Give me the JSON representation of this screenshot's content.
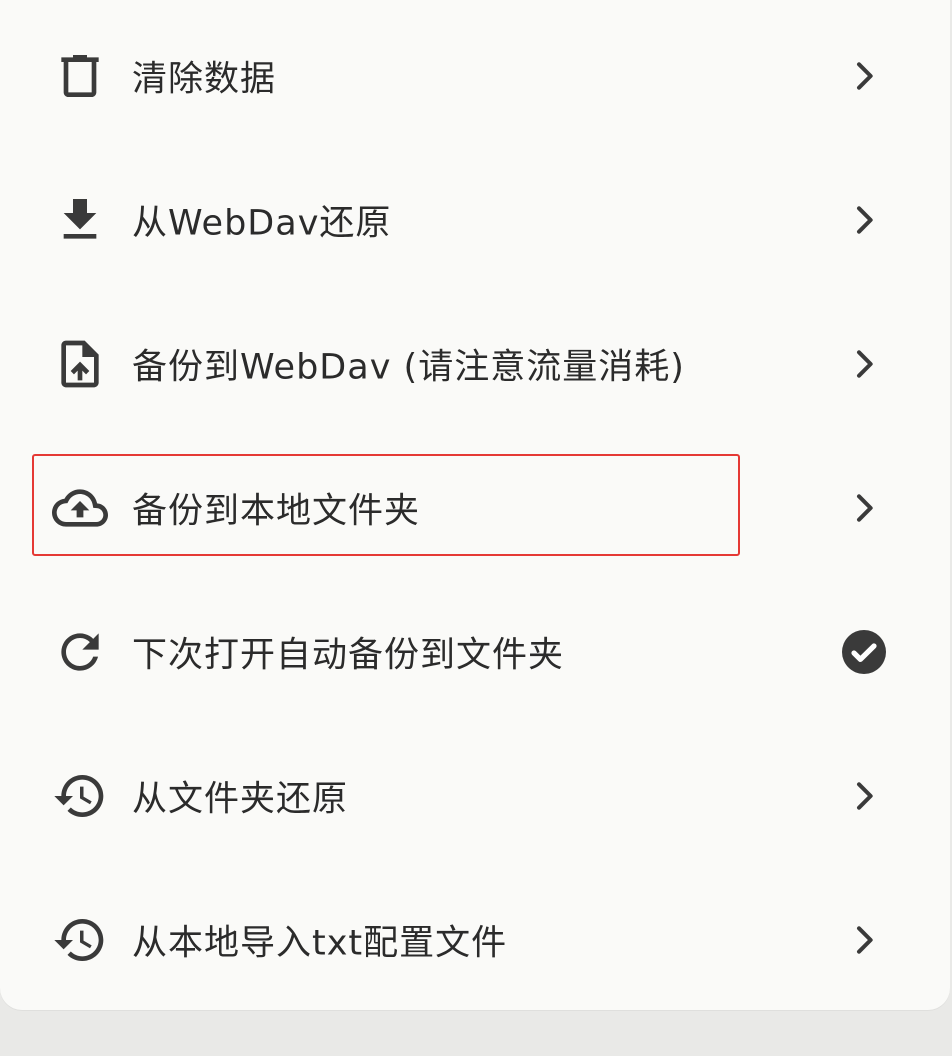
{
  "menu": {
    "items": [
      {
        "label": "清除数据",
        "icon": "trash-icon",
        "trailing": "chevron-right-icon"
      },
      {
        "label": "从WebDav还原",
        "icon": "download-icon",
        "trailing": "chevron-right-icon"
      },
      {
        "label": "备份到WebDav (请注意流量消耗)",
        "icon": "file-upload-icon",
        "trailing": "chevron-right-icon"
      },
      {
        "label": "备份到本地文件夹",
        "icon": "cloud-upload-icon",
        "trailing": "chevron-right-icon",
        "highlighted": true
      },
      {
        "label": "下次打开自动备份到文件夹",
        "icon": "refresh-icon",
        "trailing": "check-circle-icon",
        "checked": true
      },
      {
        "label": "从文件夹还原",
        "icon": "history-icon",
        "trailing": "chevron-right-icon"
      },
      {
        "label": "从本地导入txt配置文件",
        "icon": "history-icon",
        "trailing": "chevron-right-icon"
      }
    ]
  },
  "colors": {
    "background": "#e9e9e7",
    "sheet": "#fafaf8",
    "text": "#2b2b2b",
    "icon": "#3a3a3a",
    "highlight_border": "#e53935"
  }
}
